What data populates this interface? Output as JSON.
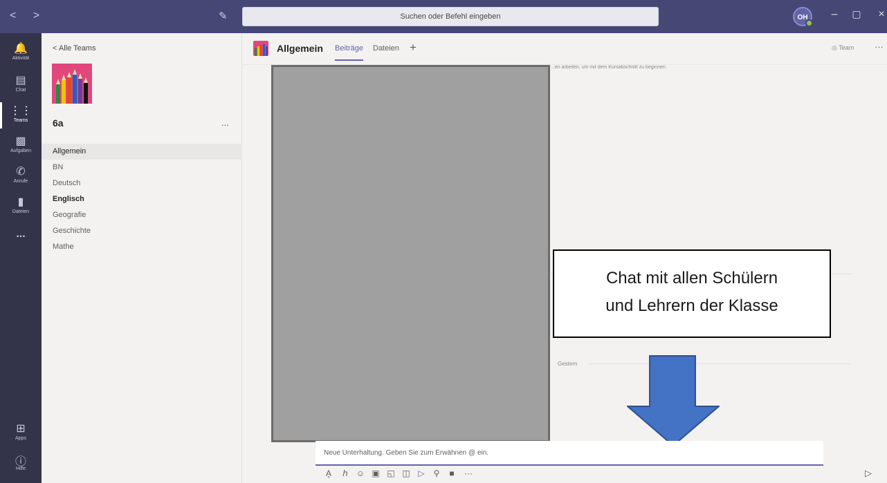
{
  "titlebar": {
    "nav": "< >",
    "search_placeholder": "Suchen oder Befehl eingeben",
    "avatar_initials": "OH",
    "minimize": "–",
    "restore": "▢",
    "close": "×"
  },
  "rail": {
    "items": [
      {
        "label": "Aktivität",
        "icon": "bell-icon"
      },
      {
        "label": "Chat",
        "icon": "chat-icon"
      },
      {
        "label": "Teams",
        "icon": "teams-icon"
      },
      {
        "label": "Aufgaben",
        "icon": "assignments-icon"
      },
      {
        "label": "Anrufe",
        "icon": "phone-icon"
      },
      {
        "label": "Dateien",
        "icon": "files-icon"
      }
    ],
    "more": "...",
    "apps_label": "Apps",
    "help_label": "Hilfe"
  },
  "left": {
    "back": "< Alle Teams",
    "team_name": "6a",
    "team_more": "...",
    "channels": [
      {
        "label": "Allgemein"
      },
      {
        "label": "BN"
      },
      {
        "label": "Deutsch"
      },
      {
        "label": "Englisch"
      },
      {
        "label": "Geografie"
      },
      {
        "label": "Geschichte"
      },
      {
        "label": "Mathe"
      }
    ]
  },
  "header": {
    "channel": "Allgemein",
    "tabs": [
      "Beiträge",
      "Dateien"
    ],
    "add_tab": "+",
    "team_btn": "◎ Team",
    "more": "···"
  },
  "messages": {
    "faded_text": "...en arbeiten, um mit dem Kursabschnitt zu beginnen.",
    "date_divider": "Gestern"
  },
  "callout": {
    "line1": "Chat mit allen Schülern",
    "line2": "und Lehrern der Klasse"
  },
  "compose": {
    "placeholder": "Neue Unterhaltung. Geben Sie zum Erwähnen @ ein."
  },
  "colors": {
    "titlebar": "#464775",
    "rail": "#33344a",
    "accent": "#6264a7",
    "arrow": "#4472c4"
  }
}
